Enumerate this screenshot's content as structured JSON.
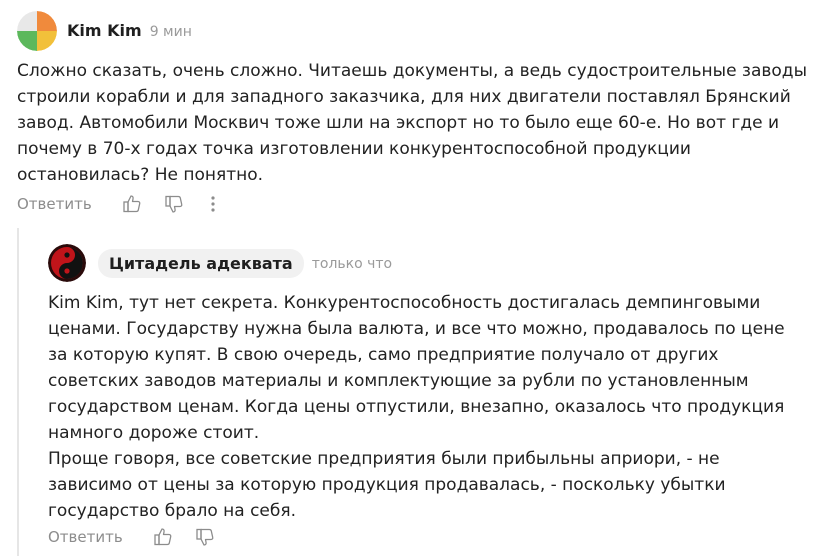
{
  "comments": [
    {
      "author": "Kim Kim",
      "time": "9 мин",
      "avatar_icon": "multicolor-circle-avatar",
      "text": "Сложно сказать, очень сложно. Читаешь документы, а ведь судостроительные заводы строили корабли и для западного заказчика, для них двигатели поставлял Брянский завод. Автомобили Москвич тоже шли на экспорт но то было еще 60-е. Но вот где и почему в 70-х годах точка изготовлении конкурентоспособной продукции остановилась? Не понятно.",
      "reply_label": "Ответить"
    },
    {
      "author": "Цитадель адекватa",
      "time": "только что",
      "avatar_icon": "yin-yang-avatar",
      "text": "Kim Kim, тут нет секрета. Конкурентоспособность достигалась демпинговыми ценами. Государству нужна была валюта, и все что можно, продавалось по цене за которую купят. В свою очередь, само предприятие получало от других советских заводов материалы и комплектующие за рубли по установленным государством ценам. Когда цены отпустили, внезапно, оказалось что продукция намного дороже стоит.\nПроще говоря, все советские предприятия были прибыльны априори, - не зависимо от цены за которую продукция продавалась, - поскольку убытки государство брало на себя.",
      "reply_label": "Ответить"
    }
  ],
  "colors": {
    "text": "#222222",
    "muted": "#8c8c8c",
    "chip": "#f1f1f1",
    "thread_line": "#e6e6e6"
  }
}
